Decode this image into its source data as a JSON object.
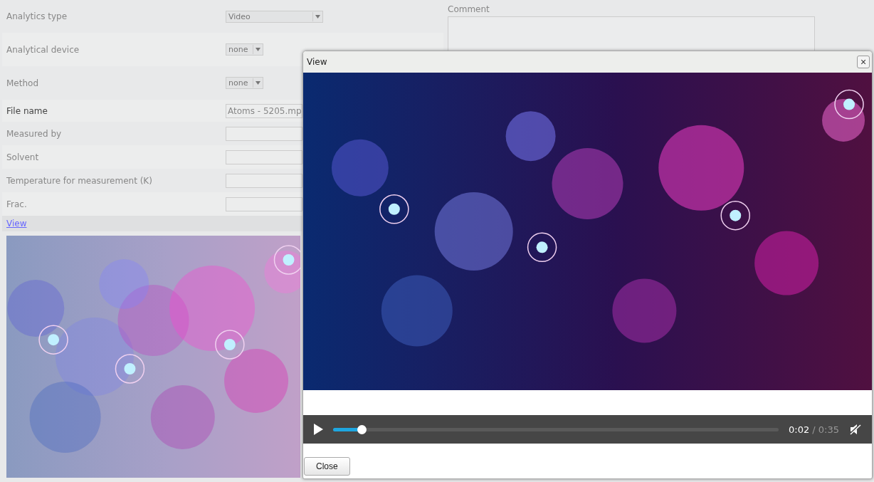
{
  "form": {
    "rows": [
      {
        "label": "Analytics type",
        "kind": "select",
        "value": "Video",
        "emphasis": false
      },
      {
        "label": "Analytical device",
        "kind": "select",
        "value": "none",
        "emphasis": false
      },
      {
        "label": "Method",
        "kind": "select",
        "value": "none",
        "emphasis": false
      },
      {
        "label": "File name",
        "kind": "text",
        "value": "Atoms - 5205.mp",
        "emphasis": true
      },
      {
        "label": "Measured by",
        "kind": "text",
        "emphasis": false
      },
      {
        "label": "Solvent",
        "kind": "text",
        "emphasis": false
      },
      {
        "label": "Temperature for measurement (K)",
        "kind": "text",
        "emphasis": false
      },
      {
        "label": "Frac.",
        "kind": "text",
        "emphasis": false
      }
    ],
    "view_link": "View"
  },
  "comment": {
    "label": "Comment"
  },
  "dialog": {
    "title": "View",
    "close_icon": "×",
    "player": {
      "playing": false,
      "level": 0.064,
      "current": "0:02",
      "duration": "/ 0:35",
      "muted": true
    },
    "button": "Close"
  }
}
